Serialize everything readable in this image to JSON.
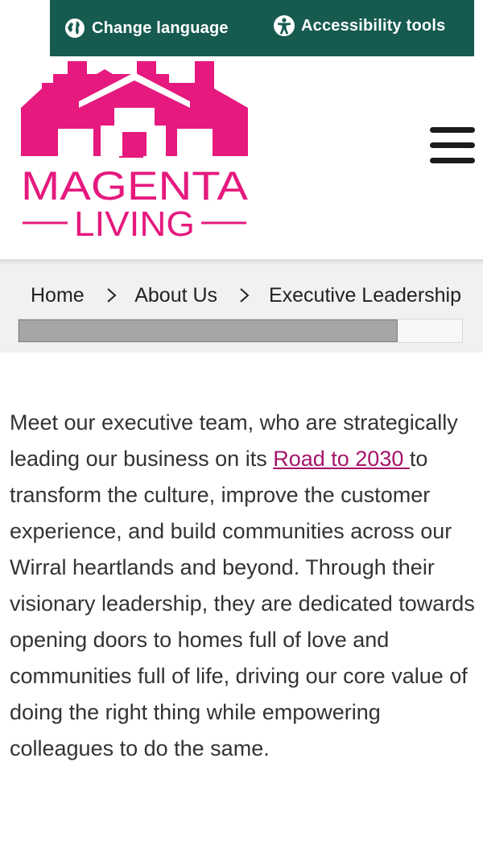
{
  "utility": {
    "language_label": "Change language",
    "accessibility_label": "Accessibility tools",
    "language_icon": "globe-icon",
    "accessibility_icon": "accessibility-person-icon",
    "bar_color": "#165a50"
  },
  "brand": {
    "name_line1": "MAGENTA",
    "name_line2": "LIVING",
    "color": "#e5197e"
  },
  "menu": {
    "icon": "hamburger-menu-icon"
  },
  "breadcrumb": {
    "items": [
      "Home",
      "About Us",
      "Executive Leadership"
    ],
    "separator_icon": "chevron-right-icon",
    "scroll_position": 0.855
  },
  "intro": {
    "before_link": "Meet our executive team, who are strategically leading our business on its ",
    "link_text": "Road to 2030 ",
    "after_link": "to transform the culture, improve the customer experience, and build communities across our Wirral heartlands and beyond. Through their visionary leadership, they are dedicated towards opening doors to homes full of love and communities full of life, driving our core value of doing the right thing while empowering colleagues to do the same.",
    "link_color": "#a51469"
  }
}
